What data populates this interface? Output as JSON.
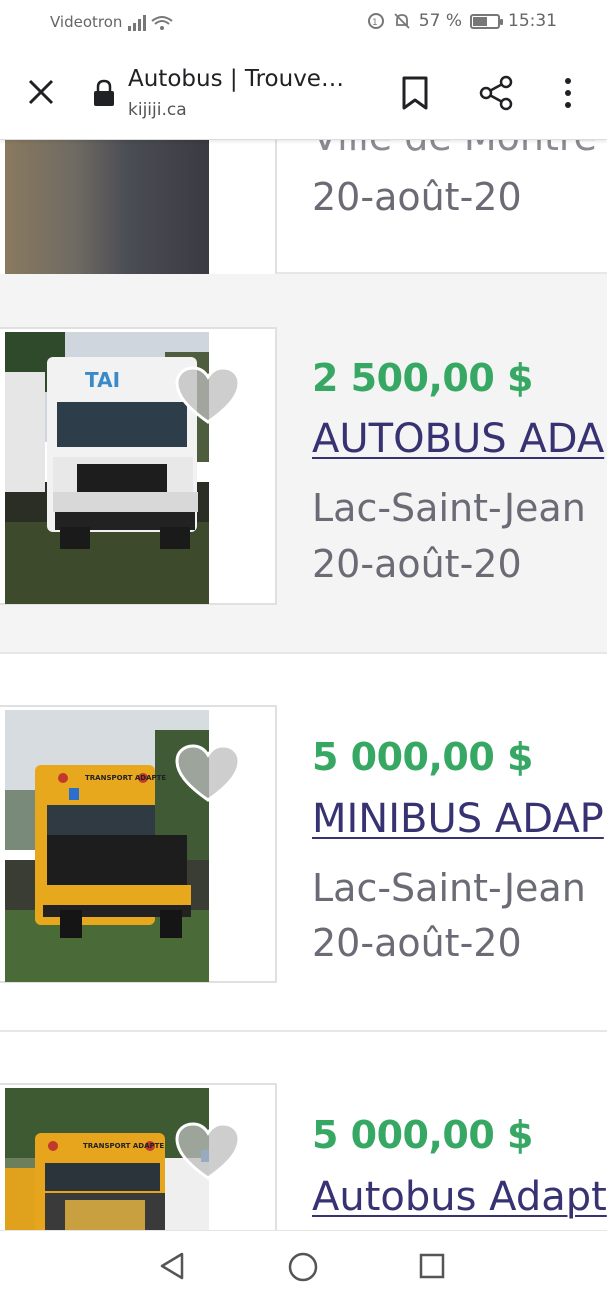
{
  "status": {
    "carrier": "Videotron",
    "battery": "57 %",
    "time": "15:31"
  },
  "browser": {
    "title": "Autobus | Trouve…",
    "url": "kijiji.ca"
  },
  "listings": [
    {
      "location": "Ville de Montré",
      "date": "20-août-20"
    },
    {
      "price": "2 500,00 $",
      "title": "AUTOBUS ADA",
      "location": "Lac-Saint-Jean",
      "date": "20-août-20"
    },
    {
      "price": "5 000,00 $",
      "title": "MINIBUS ADAP",
      "location": "Lac-Saint-Jean",
      "date": "20-août-20"
    },
    {
      "price": "5 000,00 $",
      "title": "Autobus Adapt"
    }
  ],
  "image_text": {
    "bus1_logo": "TAI",
    "bus2_sign": "TRANSPORT ADAPTE",
    "bus3_sign": "TRANSPORT ADAPTE"
  },
  "colors": {
    "price": "#37a864",
    "link": "#373373",
    "meta": "#6b6b76"
  }
}
